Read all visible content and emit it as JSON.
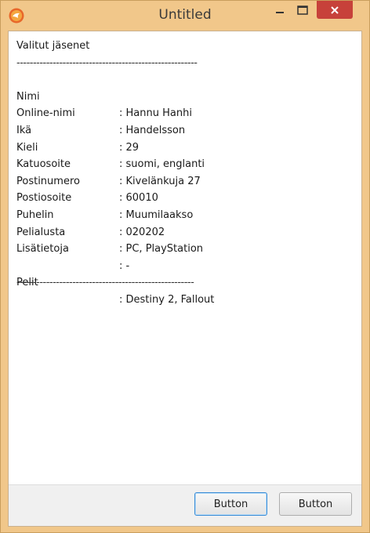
{
  "window": {
    "title": "Untitled",
    "icons": {
      "app": "app-logo-icon",
      "minimize": "minimize-icon",
      "maximize": "maximize-icon",
      "close": "close-icon"
    },
    "colors": {
      "frame": "#f1c78a",
      "close": "#c7413a"
    }
  },
  "content": {
    "heading": "Valitut jäsenet",
    "divider_top": "-------------------------------------------------------",
    "fields": [
      {
        "label": "Nimi",
        "value": ": Hannu Hanhi"
      },
      {
        "label": "Online-nimi",
        "value": ": Handelsson"
      },
      {
        "label": "Ikä",
        "value": ": 29"
      },
      {
        "label": "Kieli",
        "value": ": suomi, englanti"
      },
      {
        "label": "Katuosoite",
        "value": ": Kivelänkuja 27"
      },
      {
        "label": "Postinumero",
        "value": ": 60010"
      },
      {
        "label": "Postiosoite",
        "value": ": Muumilaakso"
      },
      {
        "label": "Puhelin",
        "value": ": 020202"
      },
      {
        "label": "Pelialusta",
        "value": ": PC, PlayStation"
      },
      {
        "label": "Lisätietoja",
        "value": ": -"
      }
    ],
    "games": {
      "label": "Pelit",
      "value": ": Destiny 2, Fallout"
    },
    "divider_bottom": "------------------------------------------------------"
  },
  "footer": {
    "button1_label": "Button",
    "button2_label": "Button"
  }
}
